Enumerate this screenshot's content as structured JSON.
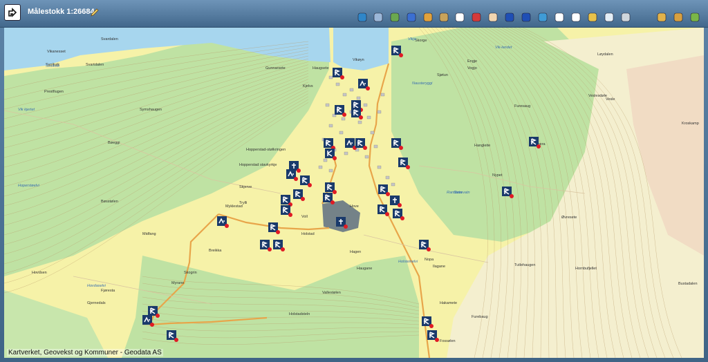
{
  "toolbar": {
    "scale_label": "Målestokk 1:26684",
    "tools": [
      {
        "name": "refresh-icon",
        "color": "#2f86c8"
      },
      {
        "name": "layers-icon",
        "color": "#9bb7d8"
      },
      {
        "name": "map-overview-icon",
        "color": "#6aa84f"
      },
      {
        "name": "search-icon",
        "color": "#3b6fd1"
      },
      {
        "name": "puzzle-icon",
        "color": "#e2a23b"
      },
      {
        "name": "brush-icon",
        "color": "#c9a35a"
      },
      {
        "name": "zoom-in-box-icon",
        "color": "#ffffff"
      },
      {
        "name": "zoom-out-icon",
        "color": "#d43a3a"
      },
      {
        "name": "pan-hand-icon",
        "color": "#f3d6b0"
      },
      {
        "name": "back-arrow-icon",
        "color": "#1f4fb5"
      },
      {
        "name": "forward-arrow-icon",
        "color": "#1f4fb5"
      },
      {
        "name": "globe-icon",
        "color": "#3f9bd6"
      },
      {
        "name": "info-icon",
        "color": "#ffffff"
      },
      {
        "name": "info-point-icon",
        "color": "#ffffff"
      },
      {
        "name": "measure-ruler-icon",
        "color": "#e8c24a"
      },
      {
        "name": "fishing-boat-icon",
        "color": "#e4eef6"
      },
      {
        "name": "filter-funnel-icon",
        "color": "#cfd6dc"
      },
      {
        "name": "add-folder-icon",
        "color": "#e2b24a"
      },
      {
        "name": "edit-map-icon",
        "color": "#d8a040"
      },
      {
        "name": "pencil-tool-icon",
        "color": "#7ab648"
      }
    ]
  },
  "map": {
    "colors": {
      "water": "#a7d6ee",
      "forest": "#bfe2a3",
      "farmland": "#f6f2a8",
      "marker_bg": "#1a3a6b",
      "marker_dot": "#e01b24",
      "road": "#e8a54a"
    },
    "place_names": [
      "Vikanesset",
      "Svolkvik",
      "Svardalen",
      "Svartdalen",
      "Prestfiugen",
      "Gunnarsete",
      "Haugsete",
      "Vikøyn",
      "Kjelvs",
      "Sjøtun",
      "Skorge",
      "Engje",
      "Vogjo",
      "Symshaugen",
      "Furesaug",
      "Veslesdøle",
      "Løydalen",
      "Bøeggi",
      "Hangleite",
      "Rambera",
      "Bøsstølen",
      "Hopperstad-stølkringen",
      "Skjerve",
      "Trylli",
      "Myklestad",
      "Hove",
      "Holstad",
      "Voll",
      "Nypet",
      "Øvresete",
      "Midfang",
      "Breikka",
      "Skogrin",
      "Myrane",
      "Hovdsen",
      "Fjøresta",
      "Vallestølen",
      "Hagen",
      "Nopa",
      "Ilagane",
      "Hakamete",
      "Fossølen",
      "Furebaug",
      "Tutlehaugen",
      "Hornbufjellet",
      "Bustadalen",
      "Vesle",
      "Kroskamp",
      "Gjernedals",
      "Hopperstad stavkyrkje",
      "Holstadsteln",
      "Haugane"
    ],
    "water_names": [
      "Svolkvik",
      "Vik kjertet",
      "Hoperstøelvi",
      "Nausteryggi",
      "Vikja",
      "Holsteinelvi",
      "Rambeta",
      "Storevatn",
      "Vik-landet",
      "Hovdaselvi"
    ],
    "attribution": "Kartverket, Geovekst og Kommuner - Geodata AS"
  }
}
